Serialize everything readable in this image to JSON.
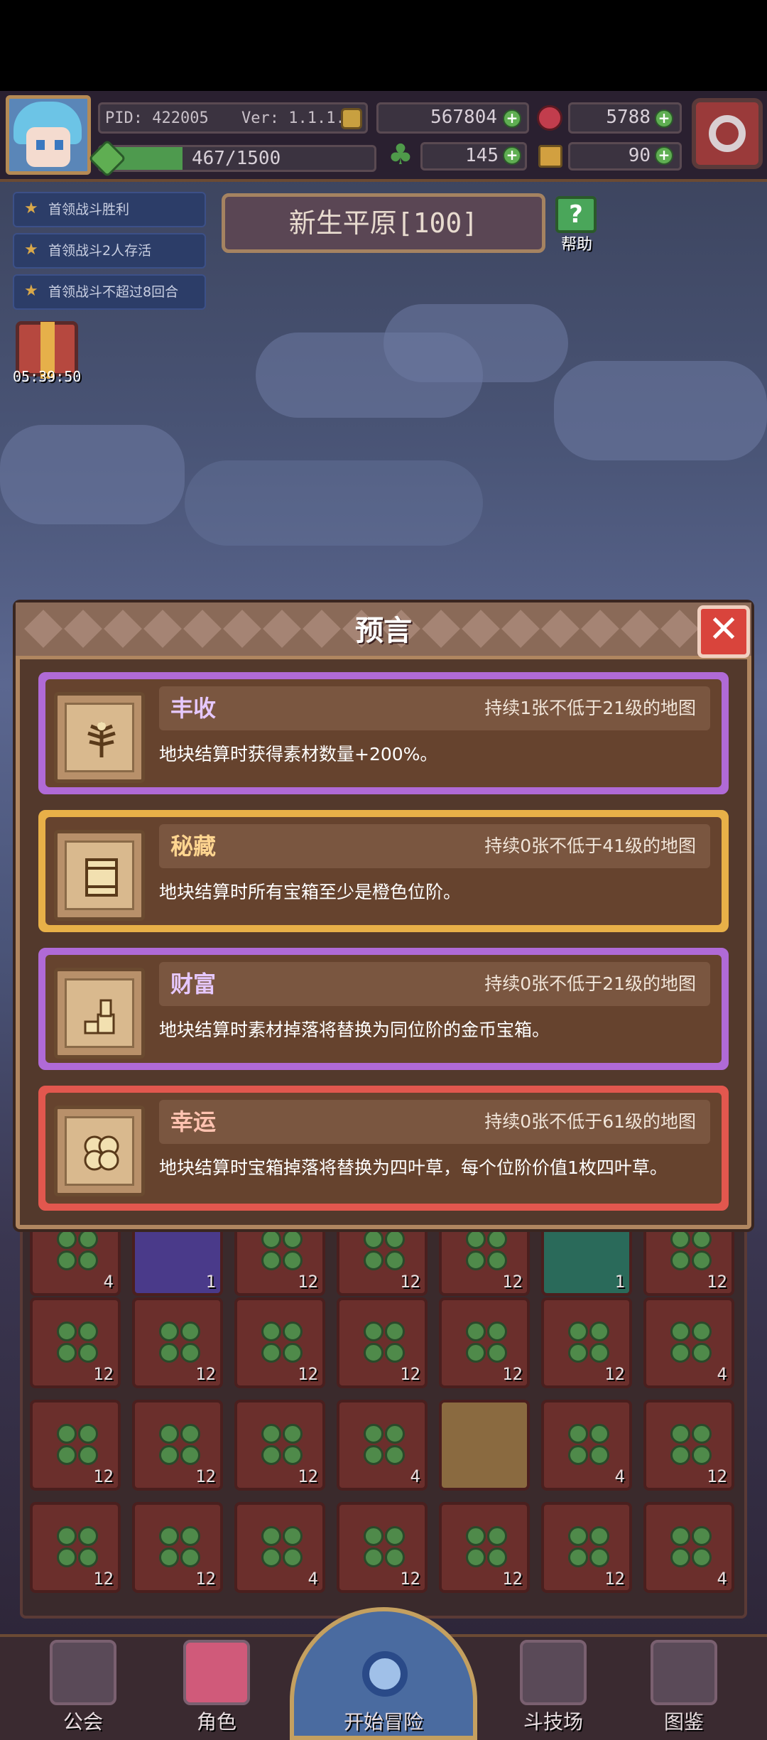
{
  "hud": {
    "pid": "PID: 422005",
    "version": "Ver: 1.1.1.3",
    "gold": "567804",
    "gems": "5788",
    "exp": "467/1500",
    "clover": "145",
    "keys": "90"
  },
  "tasks": [
    "首领战斗胜利",
    "首领战斗2人存活",
    "首领战斗不超过8回合"
  ],
  "gift_timer": "05:39:50",
  "stage": {
    "title": "新生平原[100]",
    "help_label": "帮助"
  },
  "modal": {
    "title": "预言",
    "cards": [
      {
        "name": "丰收",
        "condition": "持续1张不低于21级的地图",
        "description": "地块结算时获得素材数量+200%。",
        "frame_color": "#b06ad6"
      },
      {
        "name": "秘藏",
        "condition": "持续0张不低于41级的地图",
        "description": "地块结算时所有宝箱至少是橙色位阶。",
        "frame_color": "#e8b048"
      },
      {
        "name": "财富",
        "condition": "持续0张不低于21级的地图",
        "description": "地块结算时素材掉落将替换为同位阶的金币宝箱。",
        "frame_color": "#b06ad6"
      },
      {
        "name": "幸运",
        "condition": "持续0张不低于61级的地图",
        "description": "地块结算时宝箱掉落将替换为四叶草，每个位阶价值1枚四叶草。",
        "frame_color": "#e2574e"
      }
    ]
  },
  "grid_counts": [
    [
      "4",
      "1",
      "12",
      "12",
      "12",
      "1",
      "12"
    ],
    [
      "12",
      "12",
      "12",
      "12",
      "12",
      "12",
      "4"
    ],
    [
      "12",
      "12",
      "12",
      "4",
      "",
      "4",
      "12"
    ],
    [
      "12",
      "12",
      "4",
      "12",
      "12",
      "12",
      "4"
    ]
  ],
  "nav": {
    "guild": "公会",
    "character": "角色",
    "start": "开始冒险",
    "arena": "斗技场",
    "codex": "图鉴"
  }
}
